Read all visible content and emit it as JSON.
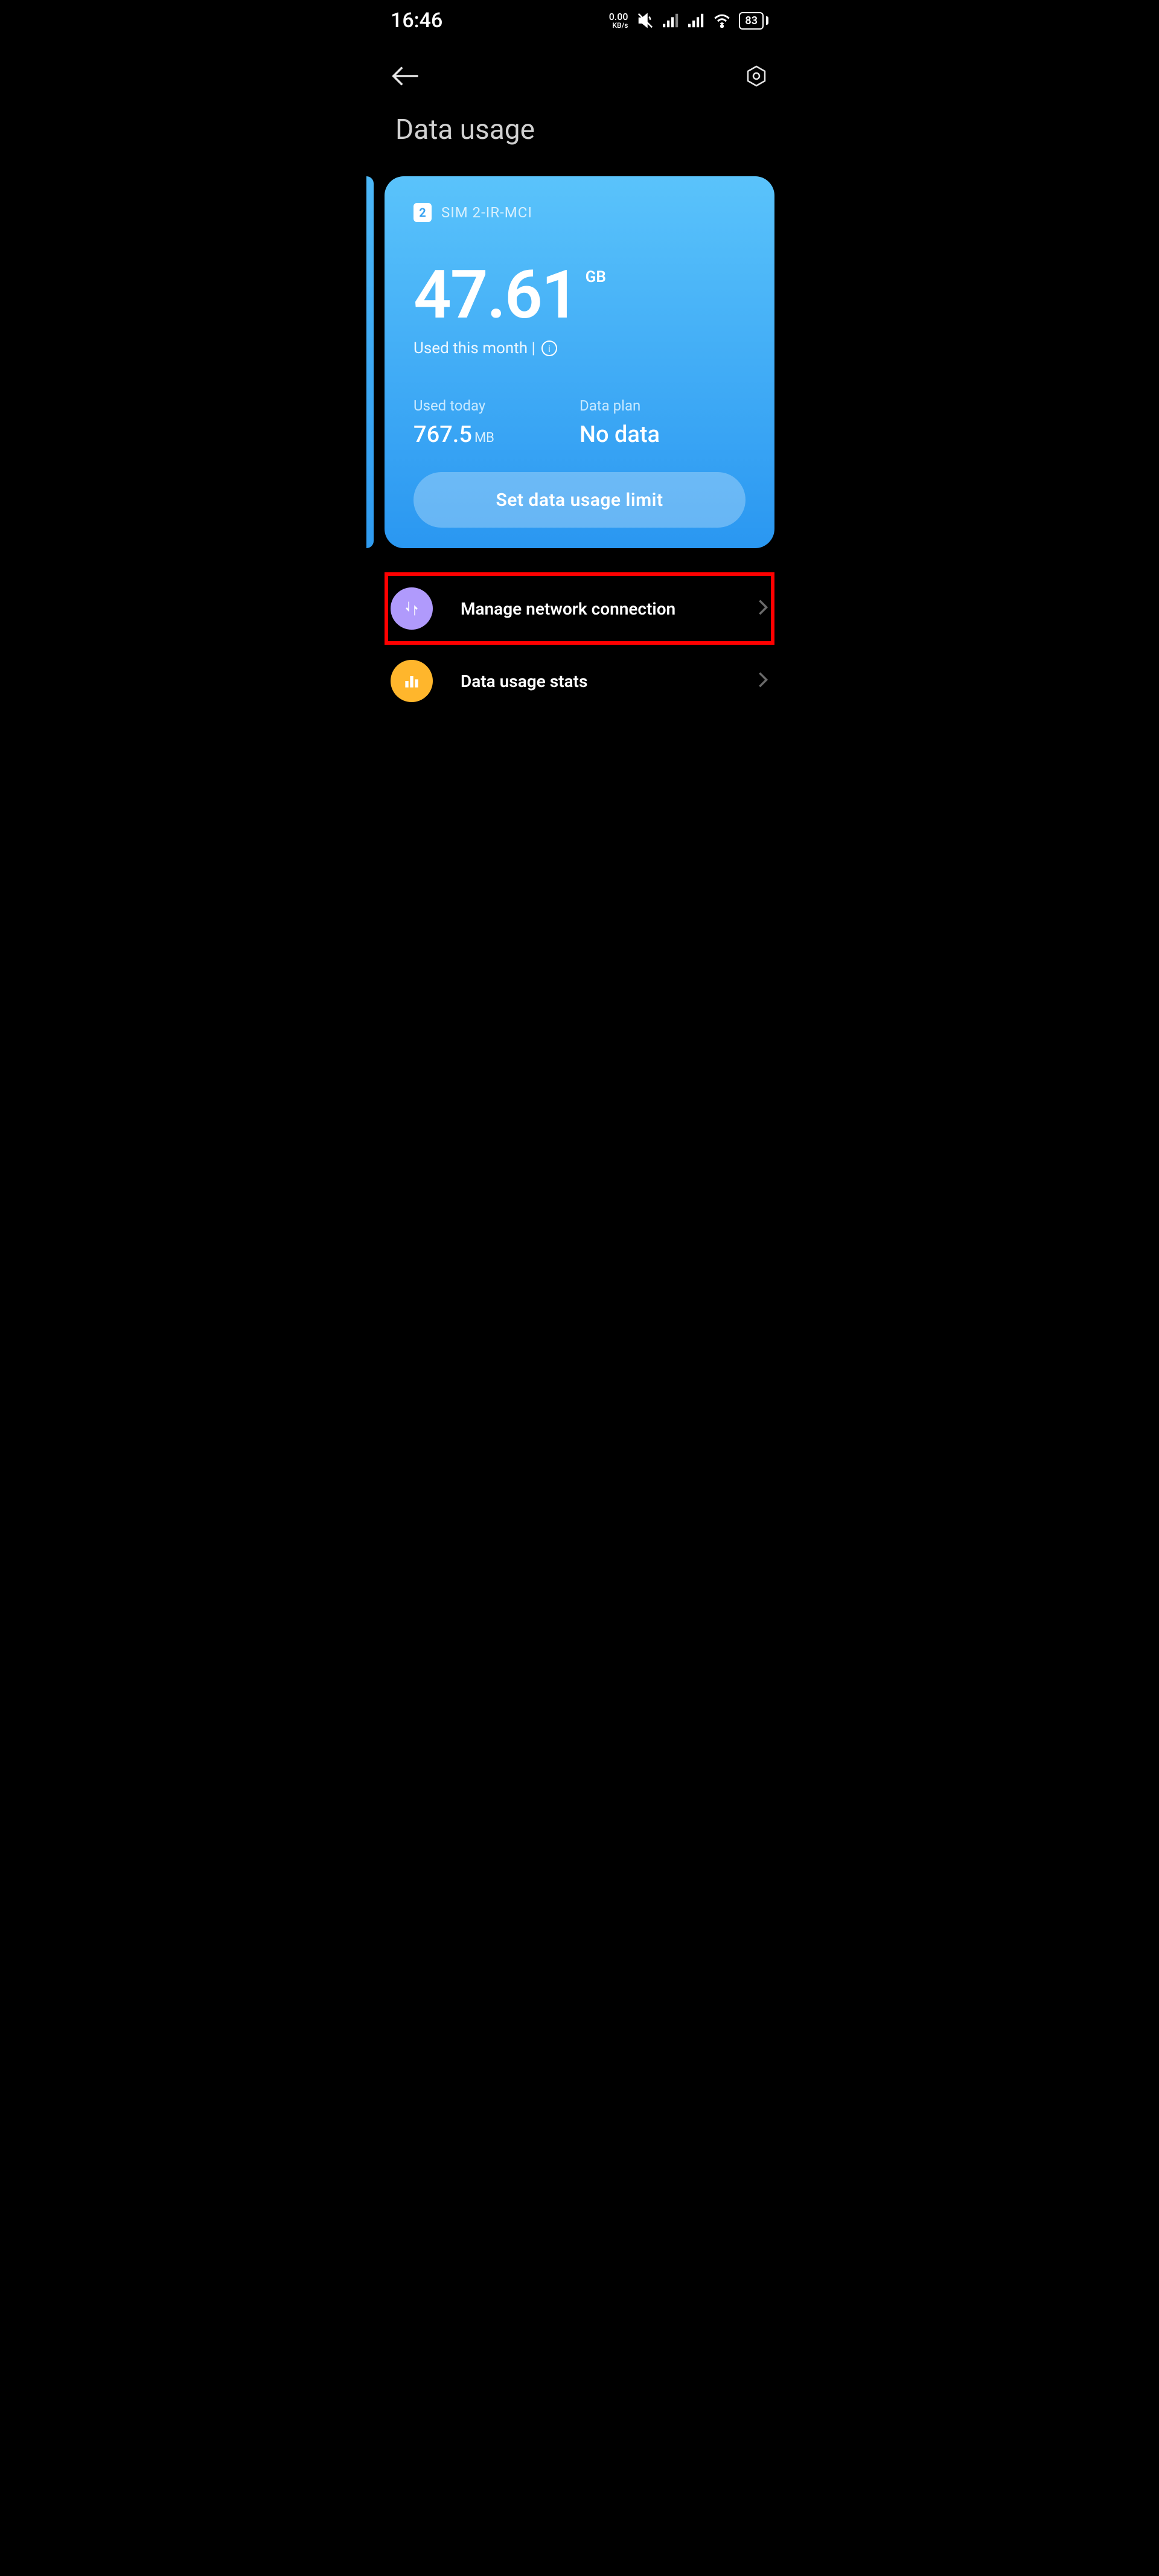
{
  "statusbar": {
    "time": "16:46",
    "kbs_top": "0.00",
    "kbs_bottom": "KB/s",
    "battery": "83"
  },
  "page": {
    "title": "Data usage"
  },
  "sim_card": {
    "badge": "2",
    "name": "SIM 2-IR-MCI",
    "usage_value": "47.61",
    "usage_unit": "GB",
    "used_month_label": "Used this month |",
    "used_today_label": "Used today",
    "used_today_value": "767.5",
    "used_today_unit": "MB",
    "data_plan_label": "Data plan",
    "data_plan_value": "No data",
    "limit_button": "Set data usage limit"
  },
  "rows": {
    "network": "Manage network connection",
    "stats": "Data usage stats"
  },
  "annotation": {
    "highlight_target": "network-row"
  }
}
